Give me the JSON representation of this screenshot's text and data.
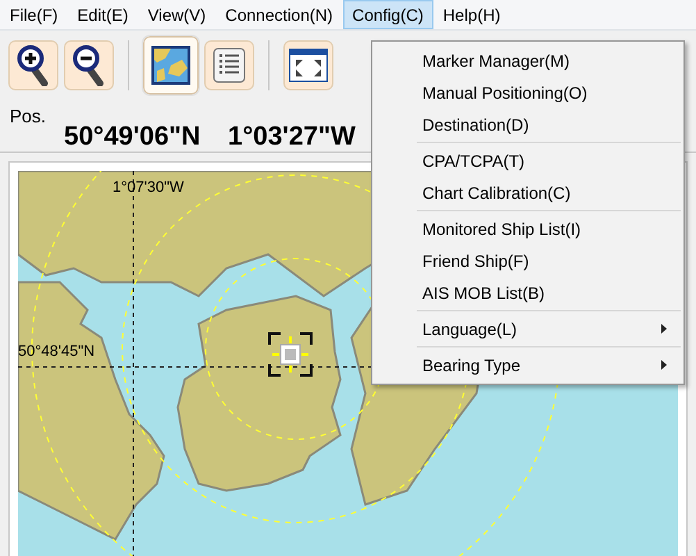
{
  "menu_bar": [
    {
      "label": "File(F)",
      "selected": false
    },
    {
      "label": "Edit(E)",
      "selected": false
    },
    {
      "label": "View(V)",
      "selected": false
    },
    {
      "label": "Connection(N)",
      "selected": false
    },
    {
      "label": "Config(C)",
      "selected": true
    },
    {
      "label": "Help(H)",
      "selected": false
    }
  ],
  "toolbar": [
    {
      "kind": "zoom-in",
      "selected": false
    },
    {
      "kind": "zoom-out",
      "selected": false
    },
    {
      "kind": "separator"
    },
    {
      "kind": "chart",
      "selected": true
    },
    {
      "kind": "list",
      "selected": false
    },
    {
      "kind": "separator"
    },
    {
      "kind": "fullscreen",
      "selected": false
    }
  ],
  "position": {
    "label": "Pos.",
    "latitude": "50°49'06\"N",
    "longitude": "1°03'27\"W"
  },
  "chart": {
    "longitude_label": "1°07'30\"W",
    "latitude_label": "50°48'45\"N"
  },
  "dropdown": {
    "groups": [
      [
        {
          "label": "Marker Manager(M)",
          "submenu": false
        },
        {
          "label": "Manual Positioning(O)",
          "submenu": false
        },
        {
          "label": "Destination(D)",
          "submenu": false
        }
      ],
      [
        {
          "label": "CPA/TCPA(T)",
          "submenu": false
        },
        {
          "label": "Chart Calibration(C)",
          "submenu": false
        }
      ],
      [
        {
          "label": "Monitored Ship List(I)",
          "submenu": false
        },
        {
          "label": "Friend Ship(F)",
          "submenu": false
        },
        {
          "label": "AIS MOB List(B)",
          "submenu": false
        }
      ],
      [
        {
          "label": "Language(L)",
          "submenu": true
        }
      ],
      [
        {
          "label": "Bearing Type",
          "submenu": true
        }
      ]
    ]
  }
}
